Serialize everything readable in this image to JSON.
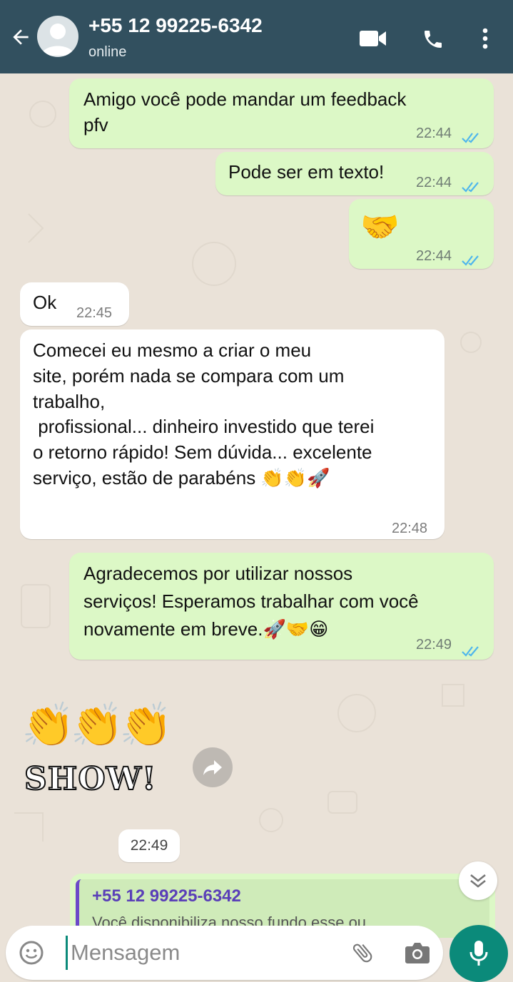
{
  "header": {
    "title": "+55 12 99225-6342",
    "status": "online",
    "icons": [
      "back-arrow-icon",
      "avatar",
      "video-call-icon",
      "phone-icon",
      "more-vert-icon"
    ]
  },
  "messages": [
    {
      "dir": "out",
      "text": "Amigo você pode mandar um feedback\npfv",
      "time": "22:44",
      "read": true
    },
    {
      "dir": "out",
      "text": "Pode ser em texto!",
      "time": "22:44",
      "read": true
    },
    {
      "dir": "out",
      "text": "🤝",
      "time": "22:44",
      "read": true
    },
    {
      "dir": "in",
      "text": "Ok",
      "time": "22:45"
    },
    {
      "dir": "in",
      "text": "Comecei eu mesmo a criar o meu\nsite, porém nada se compara com um\ntrabalho,\n profissional... dinheiro investido que terei\no retorno rápido! Sem dúvida... excelente\nserviço, estão de parabéns 👏👏🚀",
      "time": "22:48"
    },
    {
      "dir": "out",
      "text": "Agradecemos por utilizar nossos\nserviços! Esperamos trabalhar com você\nnovamente em breve.🚀🤝😁",
      "time": "22:49",
      "read": true
    }
  ],
  "sticker": {
    "text": "SHOW!",
    "emoji": "👏👏👏"
  },
  "sticker_time": "22:49",
  "quoted": {
    "name": "+55 12 99225-6342",
    "text": "Você disponibiliza nosso fundo esse ou"
  },
  "input": {
    "placeholder": "Mensagem"
  },
  "colors": {
    "header": "#32505F",
    "out_bubble": "#DCF8C6",
    "in_bubble": "#FFFFFF",
    "accent": "#0B8A7A",
    "read_ticks": "#4FB6EC"
  }
}
